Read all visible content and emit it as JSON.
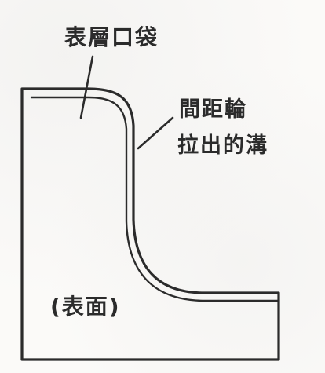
{
  "labels": {
    "pocket": "表層口袋",
    "seam_line_1": "間距輪",
    "seam_line_2": "拉出的溝",
    "face": "(表面)"
  },
  "colors": {
    "ink": "#2b2b2b",
    "paper": "#fbfaf8"
  }
}
